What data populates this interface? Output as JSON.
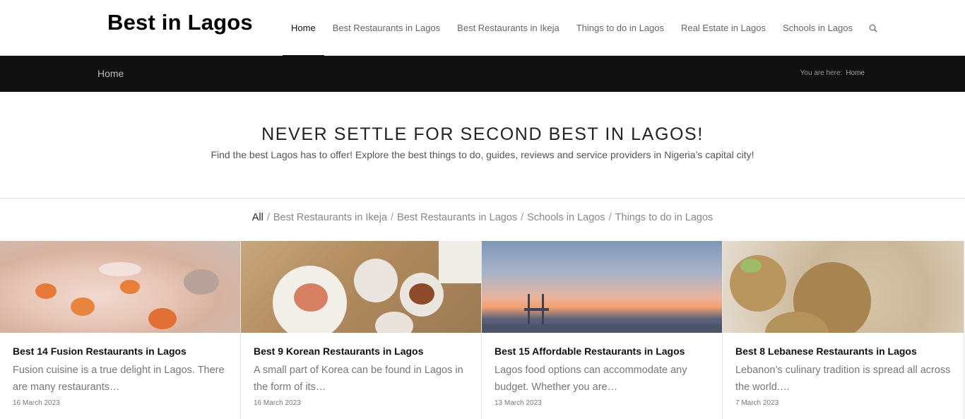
{
  "header": {
    "logo": "Best in Lagos",
    "nav": [
      {
        "label": "Home",
        "active": true
      },
      {
        "label": "Best Restaurants in Lagos"
      },
      {
        "label": "Best Restaurants in Ikeja"
      },
      {
        "label": "Things to do in Lagos"
      },
      {
        "label": "Real Estate in Lagos"
      },
      {
        "label": "Schools in Lagos"
      }
    ],
    "search_icon": "search-icon"
  },
  "titlebar": {
    "title": "Home",
    "breadcrumb_prefix": "You are here:",
    "breadcrumb_current": "Home"
  },
  "hero": {
    "heading": "NEVER SETTLE FOR SECOND BEST IN LAGOS!",
    "subheading": "Find the best Lagos has to offer! Explore the best things to do, guides, reviews and service providers in Nigeria’s capital city!"
  },
  "filters": [
    "All",
    "Best Restaurants in Ikeja",
    "Best Restaurants in Lagos",
    "Schools in Lagos",
    "Things to do in Lagos"
  ],
  "posts": [
    {
      "title": "Best 14 Fusion Restaurants in Lagos",
      "excerpt": "Fusion cuisine is a true delight in Lagos. There are many restaurants…",
      "date": "16 March 2023"
    },
    {
      "title": "Best 9 Korean Restaurants in Lagos",
      "excerpt": "A small part of Korea can be found in Lagos in the form of its…",
      "date": "16 March 2023"
    },
    {
      "title": "Best 15 Affordable Restaurants in Lagos",
      "excerpt": "Lagos food options can accommodate any budget. Whether you are…",
      "date": "13 March 2023"
    },
    {
      "title": "Best 8 Lebanese Restaurants in Lagos",
      "excerpt": "Lebanon’s culinary tradition is spread all across the world.…",
      "date": "7 March 2023"
    }
  ]
}
